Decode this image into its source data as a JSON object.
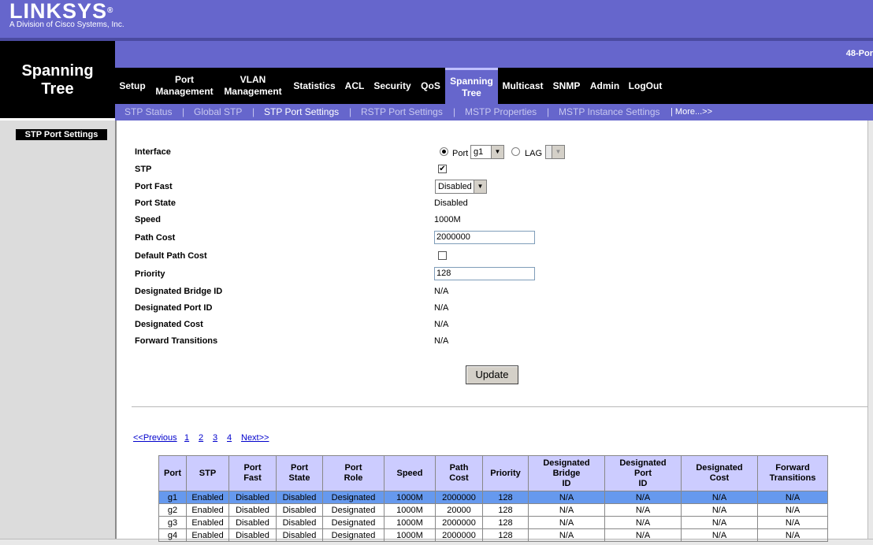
{
  "header": {
    "logo_text": "LINKSYS",
    "logo_reg": "®",
    "logo_tagline": "A Division of Cisco Systems, Inc.",
    "product_name": "48-Por",
    "section_title_line1": "Spanning",
    "section_title_line2": "Tree"
  },
  "nav": {
    "items": [
      {
        "label": "Setup"
      },
      {
        "label": "Port Management"
      },
      {
        "label": "VLAN Management"
      },
      {
        "label": "Statistics"
      },
      {
        "label": "ACL"
      },
      {
        "label": "Security"
      },
      {
        "label": "QoS"
      },
      {
        "label": "Spanning Tree"
      },
      {
        "label": "Multicast"
      },
      {
        "label": "SNMP"
      },
      {
        "label": "Admin"
      },
      {
        "label": "LogOut"
      }
    ],
    "active": "Spanning Tree"
  },
  "subnav": {
    "items": [
      {
        "label": "STP Status"
      },
      {
        "label": "Global STP"
      },
      {
        "label": "STP Port Settings"
      },
      {
        "label": "RSTP Port Settings"
      },
      {
        "label": "MSTP Properties"
      },
      {
        "label": "MSTP Instance Settings"
      }
    ],
    "separator": "|",
    "more": "| More...>>",
    "active": "STP Port Settings"
  },
  "sidebar": {
    "active_item": "STP Port Settings"
  },
  "form": {
    "interface_label": "Interface",
    "port_radio_label": "Port",
    "port_value": "g1",
    "lag_radio_label": "LAG",
    "lag_value": "",
    "stp_label": "STP",
    "stp_checked": true,
    "check_mark": "✔",
    "port_fast_label": "Port Fast",
    "port_fast_value": "Disabled",
    "port_state_label": "Port State",
    "port_state_value": "Disabled",
    "speed_label": "Speed",
    "speed_value": "1000M",
    "path_cost_label": "Path Cost",
    "path_cost_value": "2000000",
    "default_path_cost_label": "Default Path Cost",
    "default_path_cost_checked": false,
    "priority_label": "Priority",
    "priority_value": "128",
    "designated_bridge_id_label": "Designated Bridge ID",
    "designated_bridge_id_value": "N/A",
    "designated_port_id_label": "Designated Port ID",
    "designated_port_id_value": "N/A",
    "designated_cost_label": "Designated Cost",
    "designated_cost_value": "N/A",
    "forward_transitions_label": "Forward Transitions",
    "forward_transitions_value": "N/A",
    "update_button": "Update",
    "dropdown_arrow": "▼"
  },
  "pager": {
    "previous": "<<Previous",
    "pages": [
      "1",
      "2",
      "3",
      "4"
    ],
    "next": "Next>>"
  },
  "table": {
    "headers": [
      "Port",
      "STP",
      "Port\nFast",
      "Port\nState",
      "Port\nRole",
      "Speed",
      "Path\nCost",
      "Priority",
      "Designated\nBridge\nID",
      "Designated\nPort\nID",
      "Designated\nCost",
      "Forward\nTransitions"
    ],
    "rows": [
      [
        "g1",
        "Enabled",
        "Disabled",
        "Disabled",
        "Designated",
        "1000M",
        "2000000",
        "128",
        "N/A",
        "N/A",
        "N/A",
        "N/A"
      ],
      [
        "g2",
        "Enabled",
        "Disabled",
        "Disabled",
        "Designated",
        "1000M",
        "20000",
        "128",
        "N/A",
        "N/A",
        "N/A",
        "N/A"
      ],
      [
        "g3",
        "Enabled",
        "Disabled",
        "Disabled",
        "Designated",
        "1000M",
        "2000000",
        "128",
        "N/A",
        "N/A",
        "N/A",
        "N/A"
      ],
      [
        "g4",
        "Enabled",
        "Disabled",
        "Disabled",
        "Designated",
        "1000M",
        "2000000",
        "128",
        "N/A",
        "N/A",
        "N/A",
        "N/A"
      ]
    ],
    "selected_row": 0
  },
  "colors": {
    "brand_purple": "#6666cc",
    "header_black": "#000000",
    "table_header": "#ccccff",
    "selected_row": "#6699ee"
  }
}
